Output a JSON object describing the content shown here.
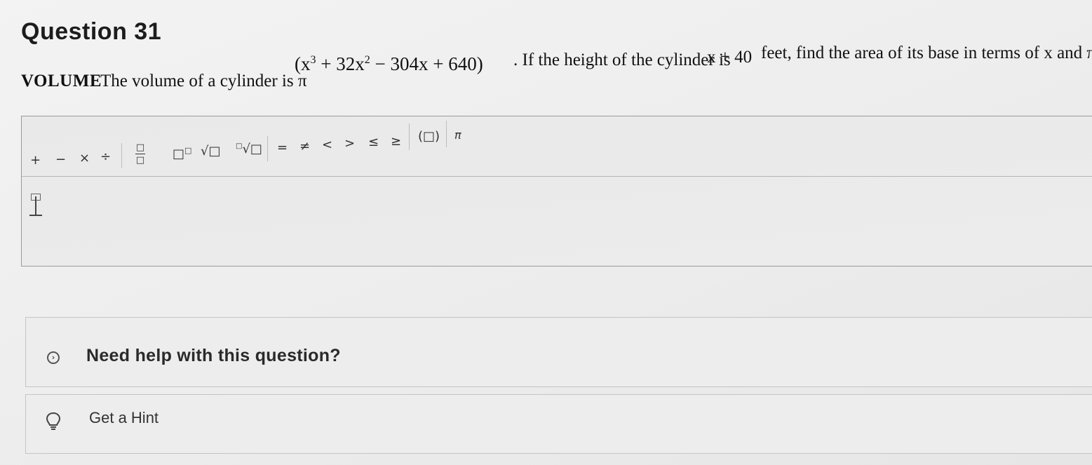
{
  "question": {
    "title": "Question 31",
    "label": "VOLUME",
    "intro": "The volume of a cylinder is π",
    "expression": {
      "open": "(x",
      "exp1": "3",
      "mid": " + 32x",
      "exp2": "2",
      "close": " − 304x + 640)"
    },
    "condition_part1": ". If the height of the cylinder is",
    "height_expr": "x + 40",
    "condition_part2": "feet, find the area of its base in terms of x and π."
  },
  "toolbar": {
    "plus": "+",
    "minus": "−",
    "times": "×",
    "divide": "÷",
    "fraction_top": "□",
    "fraction_bottom": "□",
    "exponent": "□",
    "exponent_power": "□",
    "sqrt": "√□",
    "nth_root_index": "□",
    "nth_root": "√□",
    "equals": "=",
    "not_equals": "≠",
    "less_than": "<",
    "greater_than": ">",
    "less_equal": "≤",
    "greater_equal": "≥",
    "parentheses": "(□)",
    "pi": "π"
  },
  "help": {
    "label": "Need help with this question?",
    "icon": "chevron-right-circle-icon"
  },
  "hint": {
    "label": "Get a Hint",
    "icon": "lightbulb-icon"
  }
}
